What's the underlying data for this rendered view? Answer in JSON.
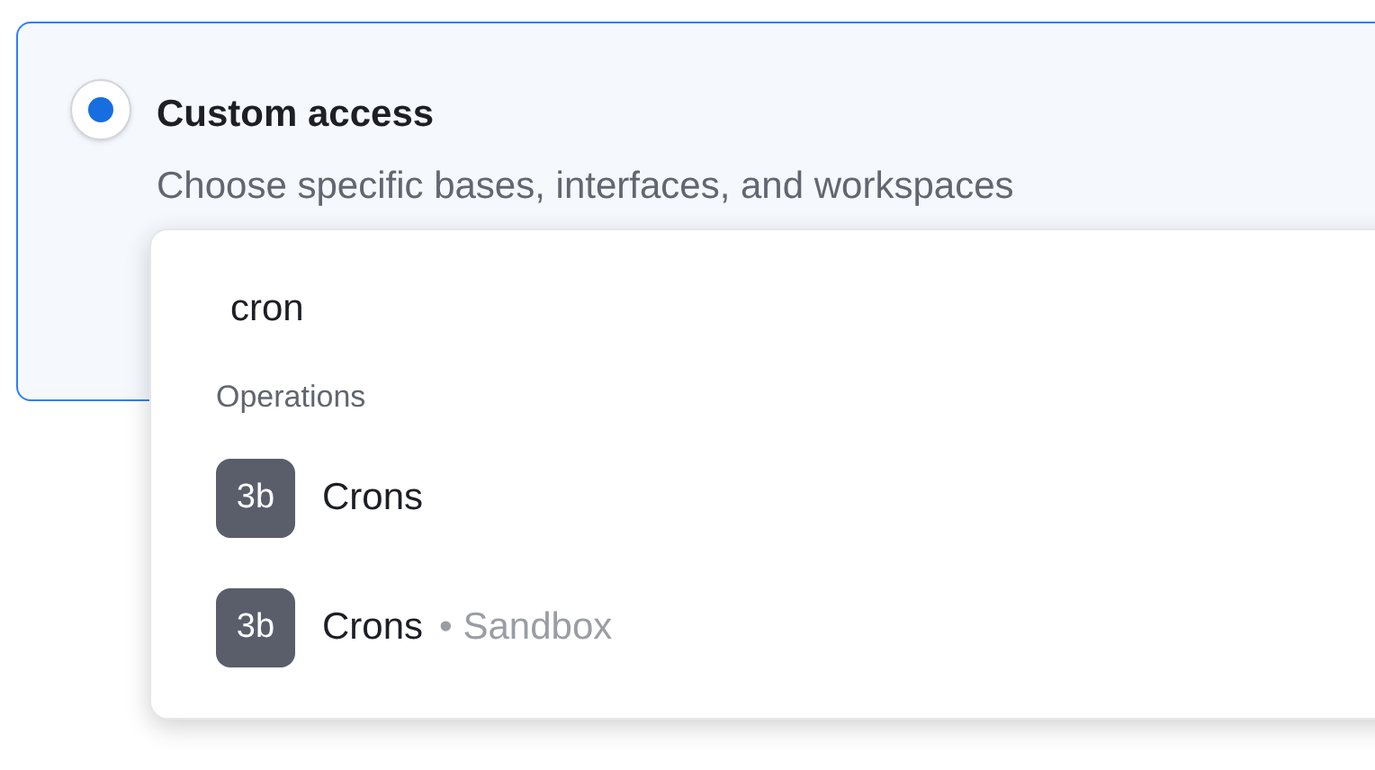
{
  "access_option": {
    "title": "Custom access",
    "description": "Choose specific bases, interfaces, and workspaces",
    "selected": true
  },
  "dropdown": {
    "search": {
      "value": "cron"
    },
    "group": "Operations",
    "items": [
      {
        "badge": "3b",
        "label": "Crons"
      },
      {
        "badge": "3b",
        "label": "Crons",
        "workspace": "Sandbox",
        "separator": "•"
      }
    ]
  }
}
